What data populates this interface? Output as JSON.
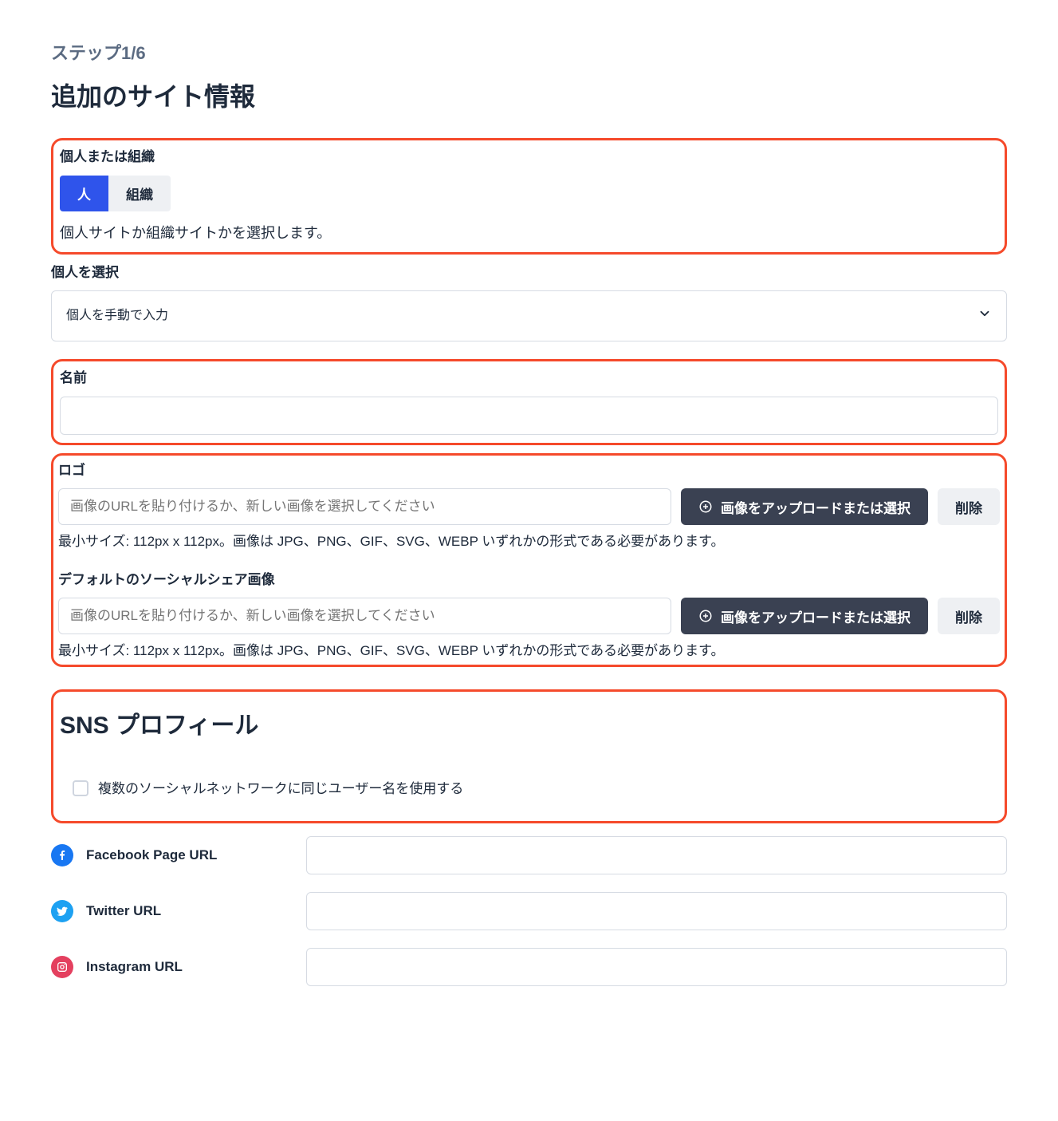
{
  "step": "ステップ1/6",
  "title": "追加のサイト情報",
  "section1": {
    "label": "個人または組織",
    "opt_person": "人",
    "opt_org": "組織",
    "help": "個人サイトか組織サイトかを選択します。"
  },
  "select_person": {
    "label": "個人を選択",
    "value": "個人を手動で入力"
  },
  "name": {
    "label": "名前"
  },
  "logo": {
    "label": "ロゴ",
    "placeholder": "画像のURLを貼り付けるか、新しい画像を選択してください",
    "upload": "画像をアップロードまたは選択",
    "delete": "削除",
    "hint": "最小サイズ: 112px x 112px。画像は JPG、PNG、GIF、SVG、WEBP いずれかの形式である必要があります。"
  },
  "share_image": {
    "label": "デフォルトのソーシャルシェア画像",
    "placeholder": "画像のURLを貼り付けるか、新しい画像を選択してください",
    "upload": "画像をアップロードまたは選択",
    "delete": "削除",
    "hint": "最小サイズ: 112px x 112px。画像は JPG、PNG、GIF、SVG、WEBP いずれかの形式である必要があります。"
  },
  "sns": {
    "title": "SNS プロフィール",
    "same_username_label": "複数のソーシャルネットワークに同じユーザー名を使用する",
    "facebook": "Facebook Page URL",
    "twitter": "Twitter URL",
    "instagram": "Instagram URL"
  }
}
